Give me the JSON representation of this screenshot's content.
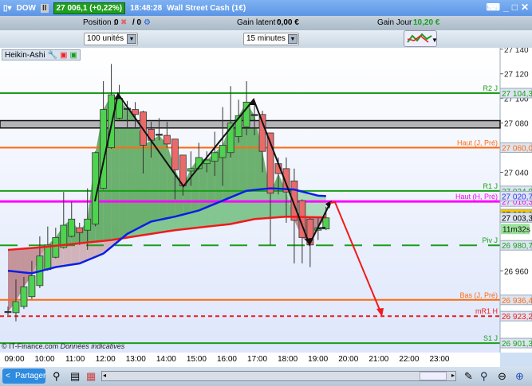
{
  "title": {
    "symbol": "DOW",
    "quote": "27 006,1 (+0,22%)",
    "time": "18:48:28",
    "instrument": "Wall Street Cash (1€)"
  },
  "info": {
    "position_label": "Position :",
    "position_value": "0",
    "position_orders": "/ 0",
    "gain_latent_label": "Gain latent :",
    "gain_latent_value": "0,00 €",
    "gain_jour_label": "Gain Jour :",
    "gain_jour_value": "10,20 €"
  },
  "toolbar": {
    "quantity": "100 unités",
    "timeframe": "15 minutes"
  },
  "chart": {
    "type_label": "Heikin-Ashi",
    "copyright": "© IT-Finance.com",
    "disclaimer": "Données indicatives",
    "countdown": "11m32s"
  },
  "colors": {
    "up": "#4fd24f",
    "down": "#e86a6a",
    "ma_fast": "#0a1ee6",
    "ma_slow": "#f01a1a",
    "pivot_green": "#1a9e1a",
    "orange": "#ff6a10",
    "magenta": "#ff00ff"
  },
  "chart_data": {
    "type": "candlestick",
    "ylim": [
      26890,
      27145
    ],
    "price_ticks": [
      "27 140",
      "27 120",
      "27 100",
      "27 080",
      "27 040",
      "26 960"
    ],
    "price_tick_values": [
      27140,
      27120,
      27100,
      27080,
      27040,
      26960
    ],
    "time_labels": [
      "09:00",
      "10:00",
      "11:00",
      "12:00",
      "13:00",
      "14:00",
      "15:00",
      "16:00",
      "17:00",
      "18:00",
      "19:00",
      "20:00",
      "21:00",
      "22:00",
      "23:00"
    ],
    "candles": [
      [
        26927,
        26931,
        26924,
        26926.5
      ],
      [
        26926,
        26953,
        26919,
        26935
      ],
      [
        26931,
        26955,
        26929,
        26947
      ],
      [
        26939,
        26968,
        26937,
        26956
      ],
      [
        26948,
        26988,
        26946,
        26972
      ],
      [
        26961,
        26996,
        26960,
        26981
      ],
      [
        26971,
        26995,
        26970,
        26987
      ],
      [
        26979,
        27024,
        26978,
        26997
      ],
      [
        26988,
        27016,
        26987,
        27002
      ],
      [
        26995,
        26999,
        26981,
        26991
      ],
      [
        26993,
        27027,
        26977,
        27002
      ],
      [
        26998,
        27057,
        26996,
        27056
      ],
      [
        27027,
        27114,
        27026,
        27091
      ],
      [
        27060,
        27128,
        27059,
        27103
      ],
      [
        27084,
        27111,
        27083,
        27100
      ],
      [
        27092,
        27098,
        27076,
        27091
      ],
      [
        27091,
        27097,
        27076,
        27087
      ],
      [
        27089,
        27090,
        27039,
        27062
      ],
      [
        27075,
        27081,
        27052,
        27066
      ],
      [
        27071,
        27084,
        27066,
        27070
      ],
      [
        27070,
        27081,
        27060,
        27063
      ],
      [
        27067,
        27067,
        27018,
        27042
      ],
      [
        27054,
        27054,
        27021,
        27029
      ],
      [
        27041,
        27057,
        27029,
        27043
      ],
      [
        27043,
        27064,
        27042,
        27052
      ],
      [
        27047,
        27057,
        27040,
        27050
      ],
      [
        27049,
        27073,
        27037,
        27056
      ],
      [
        27052,
        27093,
        27029,
        27062
      ],
      [
        27056,
        27110,
        27052,
        27080
      ],
      [
        27069,
        27099,
        27064,
        27086
      ],
      [
        27077,
        27114,
        27070,
        27097
      ],
      [
        27087,
        27098,
        27070,
        27086
      ],
      [
        27087,
        27090,
        27040,
        27057
      ],
      [
        27072,
        27072,
        26981,
        27023
      ],
      [
        27047,
        27052,
        27022,
        27039
      ],
      [
        27043,
        27052,
        26999,
        27024
      ],
      [
        27033,
        27043,
        26966,
        27001
      ],
      [
        27017,
        27018,
        26966,
        26987
      ],
      [
        27002,
        27003,
        26963,
        26981
      ],
      [
        26993,
        27003,
        26985,
        26995
      ],
      [
        26994,
        27012,
        26993,
        27003
      ]
    ],
    "ma_fast": [
      [
        0,
        26960
      ],
      [
        3,
        26958
      ],
      [
        6,
        26963
      ],
      [
        9,
        26966
      ],
      [
        12,
        26974
      ],
      [
        15,
        26990
      ],
      [
        18,
        27000
      ],
      [
        21,
        27004
      ],
      [
        24,
        27009
      ],
      [
        27,
        27017
      ],
      [
        30,
        27025
      ],
      [
        33,
        27027
      ],
      [
        36,
        27026
      ],
      [
        39,
        27021
      ],
      [
        40,
        27020.7
      ]
    ],
    "ma_slow": [
      [
        0,
        26977
      ],
      [
        4,
        26979
      ],
      [
        13,
        26985
      ],
      [
        21,
        26993
      ],
      [
        28,
        26998
      ],
      [
        31,
        27002
      ],
      [
        35,
        27004
      ],
      [
        40,
        27003.3
      ]
    ],
    "levels": [
      {
        "label": "R2 J",
        "value": 27104.3,
        "text": "27 104,3",
        "color": "#1a9e1a",
        "style": "solid"
      },
      {
        "label": "Haut (J, Pré)",
        "value": 27060.0,
        "text": "27 060,0",
        "color": "#ff6a10",
        "style": "solid"
      },
      {
        "label": "R1 J",
        "value": 27024.9,
        "text": "27 024,9",
        "color": "#1a9e1a",
        "style": "solid"
      },
      {
        "label": "Haut (H, Pré)",
        "value": 27016.3,
        "text": "27 016,3",
        "color": "#ff00ff",
        "style": "thick"
      },
      {
        "label": "Piv J",
        "value": 26980.7,
        "text": "26 980,7",
        "color": "#1a9e1a",
        "style": "dashed"
      },
      {
        "label": "Bas (J, Pré)",
        "value": 26936.4,
        "text": "26 936,4",
        "color": "#ff6a10",
        "style": "solid"
      },
      {
        "label": "mR1 H",
        "value": 26923.2,
        "text": "26 923,2",
        "color": "#f01a1a",
        "style": "dotted"
      },
      {
        "label": "S1 J",
        "value": 26901.3,
        "text": "26 901,3",
        "color": "#1a9e1a",
        "style": "solid"
      }
    ],
    "zone": [
      27076,
      27082
    ],
    "tags": [
      {
        "text": "27 020,7",
        "value": 27020.7,
        "color": "#3333ff",
        "bg": "#dde4f0"
      },
      {
        "text": "27 006,1",
        "value": 27006.1,
        "color": "#000",
        "bg": "#f5c400"
      },
      {
        "text": "27 003,3",
        "value": 27003.3,
        "color": "#000",
        "bg": "#dde4f0"
      }
    ]
  },
  "bottom": {
    "share": "Partager"
  }
}
